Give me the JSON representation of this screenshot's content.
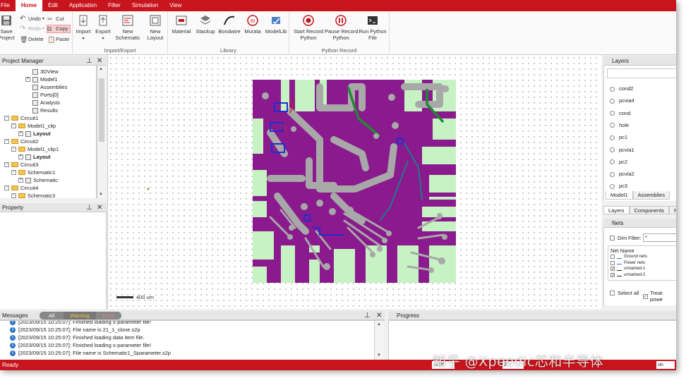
{
  "menu": [
    "File",
    "Home",
    "Edit",
    "Application",
    "Filter",
    "Simulation",
    "View"
  ],
  "ribbon": {
    "save_label": "Save\nProject",
    "undo": "Undo",
    "redo": "Redo",
    "delete": "Delete",
    "cut": "Cut",
    "copy": "Copy",
    "paste": "Paste",
    "import": "Import",
    "export": "Export",
    "new_schematic": "New\nSchematic",
    "new_layout": "New\nLayout",
    "import_export_group": "Import/Export",
    "material": "Material",
    "stackup": "Stackup",
    "bondwire": "Bondwire",
    "murata": "Murata",
    "modellib": "ModelLib",
    "library_group": "Library",
    "start_record": "Start Record\nPython",
    "pause_record": "Pause Record\nPython",
    "run_python": "Run Python\nFile",
    "python_group": "Python Record"
  },
  "project_manager": {
    "title": "Project Manager",
    "items": [
      {
        "label": "3DView",
        "indent": 4,
        "kind": "item",
        "bold": false
      },
      {
        "label": "Model1",
        "indent": 3,
        "kind": "expand",
        "bold": false
      },
      {
        "label": "Assemblies",
        "indent": 4,
        "kind": "item",
        "bold": false
      },
      {
        "label": "Ports[0]",
        "indent": 4,
        "kind": "item",
        "bold": false
      },
      {
        "label": "Analysis",
        "indent": 4,
        "kind": "item",
        "bold": false
      },
      {
        "label": "Results",
        "indent": 4,
        "kind": "item",
        "bold": false
      },
      {
        "label": "Circuit1",
        "indent": 0,
        "kind": "folder",
        "bold": false
      },
      {
        "label": "Model1_clip",
        "indent": 1,
        "kind": "folder",
        "bold": false
      },
      {
        "label": "Layout",
        "indent": 2,
        "kind": "expand",
        "bold": true
      },
      {
        "label": "Circuit2",
        "indent": 0,
        "kind": "folder",
        "bold": false
      },
      {
        "label": "Model1_clip1",
        "indent": 1,
        "kind": "folder",
        "bold": false
      },
      {
        "label": "Layout",
        "indent": 2,
        "kind": "expand",
        "bold": true
      },
      {
        "label": "Circuit3",
        "indent": 0,
        "kind": "folder",
        "bold": false
      },
      {
        "label": "Schematic1",
        "indent": 1,
        "kind": "folder",
        "bold": false
      },
      {
        "label": "Schematic",
        "indent": 2,
        "kind": "expand",
        "bold": false
      },
      {
        "label": "Circuit4",
        "indent": 0,
        "kind": "folder",
        "bold": false
      },
      {
        "label": "Schematic3",
        "indent": 1,
        "kind": "folder",
        "bold": false
      }
    ]
  },
  "property": {
    "title": "Property"
  },
  "canvas": {
    "scale_label": "400 um"
  },
  "layers": {
    "title": "Layers",
    "items": [
      "cond2",
      "pcvia4",
      "cond",
      "hole",
      "pc1",
      "pcvia1",
      "pc2",
      "pcvia2",
      "pc3"
    ],
    "tabs": [
      "Model1",
      "Assemblies"
    ],
    "bottom_tabs": [
      "Layers",
      "Components",
      "PC"
    ]
  },
  "nets": {
    "title": "Nets",
    "dim_label": "Dim",
    "filter_label": "Filter:",
    "filter_value": "*",
    "column": "Net Name",
    "items": [
      "Ground nets",
      "Power nets",
      "unnamed-1",
      "unnamed-2"
    ],
    "select_all": "Select all",
    "treat_power": "Treat powe"
  },
  "messages": {
    "title": "Messages",
    "filters": [
      "All",
      "Warning",
      "Error"
    ],
    "rows": [
      "[2023/09/15 10:25:07]: Finished loading s-parameter file!",
      "[2023/09/15 10:25:07]: File name is 21_1_clone.s2p",
      "[2023/09/15 10:25:07]: Finished loading data item file.",
      "[2023/09/15 10:25:07]: Finished loading s-parameter file!",
      "[2023/09/15 10:25:07]: File name is Schematic1_Sparameter.s2p"
    ]
  },
  "progress": {
    "title": "Progress"
  },
  "status": {
    "text": "Ready",
    "field1": "-0.30",
    "field2": "2",
    "field3": "un"
  },
  "watermark": "知乎 @Xpeedic芯和半导体",
  "colors": {
    "accent": "#c8141c",
    "board": "#8a1a8e",
    "pad": "#c7f2c4",
    "trace": "#a8a8a8"
  }
}
